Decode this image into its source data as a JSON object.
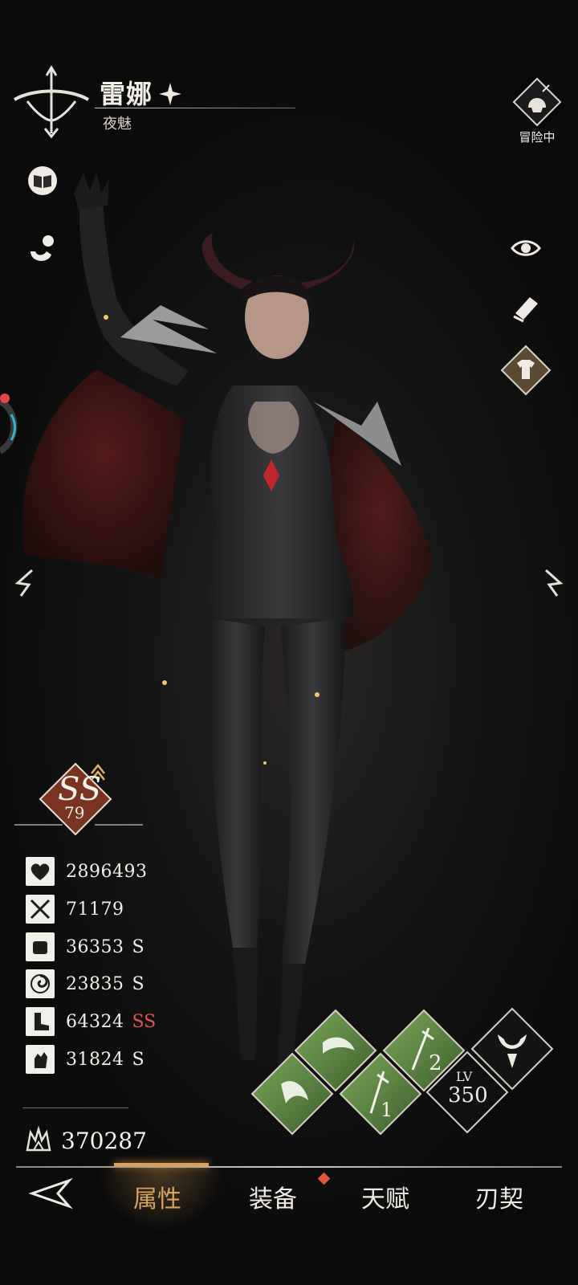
{
  "header": {
    "character_name": "雷娜",
    "character_title": "夜魅",
    "status_label": "冒险中"
  },
  "rank": {
    "grade": "SS",
    "level": "79"
  },
  "stats": [
    {
      "icon": "heart-icon",
      "value": "2896493",
      "grade": ""
    },
    {
      "icon": "crossed-swords-icon",
      "value": "71179",
      "grade": ""
    },
    {
      "icon": "fist-icon",
      "value": "36353",
      "grade": "S"
    },
    {
      "icon": "vortex-icon",
      "value": "23835",
      "grade": "S"
    },
    {
      "icon": "boot-icon",
      "value": "64324",
      "grade": "SS"
    },
    {
      "icon": "hand-icon",
      "value": "31824",
      "grade": "S"
    }
  ],
  "power": {
    "icon": "crown-emblem-icon",
    "value": "370287"
  },
  "skills": {
    "badge_1": "1",
    "badge_2": "2",
    "level_prefix": "LV",
    "level_value": "350"
  },
  "tabs": [
    {
      "label": "属性",
      "active": true
    },
    {
      "label": "装备",
      "active": false,
      "has_notification": true
    },
    {
      "label": "天赋",
      "active": false
    },
    {
      "label": "刃契",
      "active": false
    }
  ],
  "colors": {
    "accent_gold": "#d7a460",
    "grade_ss_red": "#e0554f",
    "skill_green": "#5d8a45",
    "rank_rust": "#8a3a22"
  }
}
